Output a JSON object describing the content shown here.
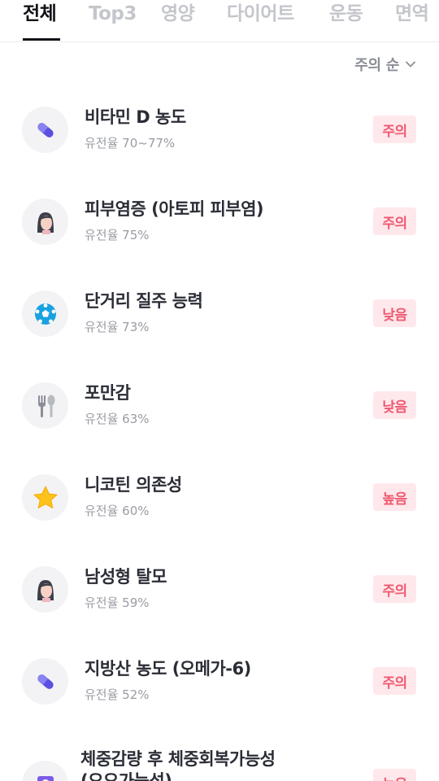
{
  "tabs": [
    {
      "label": "전체",
      "active": true
    },
    {
      "label": "Top3",
      "active": false
    },
    {
      "label": "영양",
      "active": false
    },
    {
      "label": "다이어트",
      "active": false
    },
    {
      "label": "운동",
      "active": false
    },
    {
      "label": "면역",
      "active": false
    }
  ],
  "sort": {
    "label": "주의 순",
    "icon": "chevron-down-icon"
  },
  "items": [
    {
      "title": "비타민 D 농도",
      "heritability": "유전율 70~77%",
      "status": "주의",
      "icon": "pill-icon"
    },
    {
      "title": "피부염증 (아토피 피부염)",
      "heritability": "유전율 75%",
      "status": "주의",
      "icon": "face-icon"
    },
    {
      "title": "단거리 질주 능력",
      "heritability": "유전율 73%",
      "status": "낮음",
      "icon": "soccer-ball-icon"
    },
    {
      "title": "포만감",
      "heritability": "유전율 63%",
      "status": "낮음",
      "icon": "fork-spoon-icon"
    },
    {
      "title": "니코틴 의존성",
      "heritability": "유전율 60%",
      "status": "높음",
      "icon": "star-icon"
    },
    {
      "title": "남성형 탈모",
      "heritability": "유전율 59%",
      "status": "주의",
      "icon": "face-icon"
    },
    {
      "title": "지방산 농도 (오메가-6)",
      "heritability": "유전율 52%",
      "status": "주의",
      "icon": "pill-icon"
    },
    {
      "title": "체중감량 후 체중회복가능성",
      "title_line2": "(요요가능성)",
      "heritability": "",
      "status": "높음",
      "icon": "scale-icon"
    }
  ],
  "colors": {
    "badge_bg": "#ffe8eb",
    "badge_text": "#ef5a72",
    "pill": "#5a4fe0",
    "star": "#ffc21c",
    "ball": "#1aa1e0"
  }
}
